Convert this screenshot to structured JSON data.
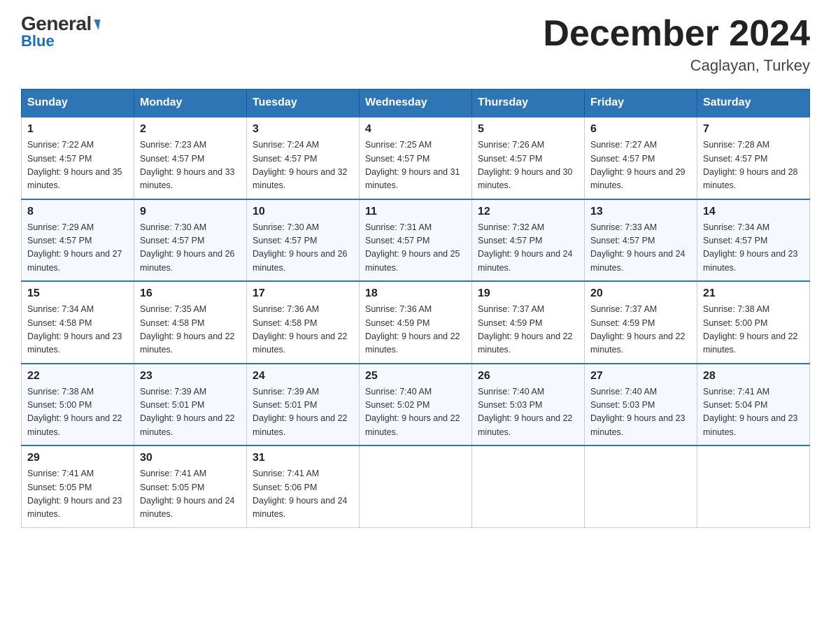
{
  "header": {
    "logo_general": "General",
    "logo_blue": "Blue",
    "month_title": "December 2024",
    "location": "Caglayan, Turkey"
  },
  "days_of_week": [
    "Sunday",
    "Monday",
    "Tuesday",
    "Wednesday",
    "Thursday",
    "Friday",
    "Saturday"
  ],
  "weeks": [
    [
      {
        "day": "1",
        "sunrise": "7:22 AM",
        "sunset": "4:57 PM",
        "daylight": "9 hours and 35 minutes."
      },
      {
        "day": "2",
        "sunrise": "7:23 AM",
        "sunset": "4:57 PM",
        "daylight": "9 hours and 33 minutes."
      },
      {
        "day": "3",
        "sunrise": "7:24 AM",
        "sunset": "4:57 PM",
        "daylight": "9 hours and 32 minutes."
      },
      {
        "day": "4",
        "sunrise": "7:25 AM",
        "sunset": "4:57 PM",
        "daylight": "9 hours and 31 minutes."
      },
      {
        "day": "5",
        "sunrise": "7:26 AM",
        "sunset": "4:57 PM",
        "daylight": "9 hours and 30 minutes."
      },
      {
        "day": "6",
        "sunrise": "7:27 AM",
        "sunset": "4:57 PM",
        "daylight": "9 hours and 29 minutes."
      },
      {
        "day": "7",
        "sunrise": "7:28 AM",
        "sunset": "4:57 PM",
        "daylight": "9 hours and 28 minutes."
      }
    ],
    [
      {
        "day": "8",
        "sunrise": "7:29 AM",
        "sunset": "4:57 PM",
        "daylight": "9 hours and 27 minutes."
      },
      {
        "day": "9",
        "sunrise": "7:30 AM",
        "sunset": "4:57 PM",
        "daylight": "9 hours and 26 minutes."
      },
      {
        "day": "10",
        "sunrise": "7:30 AM",
        "sunset": "4:57 PM",
        "daylight": "9 hours and 26 minutes."
      },
      {
        "day": "11",
        "sunrise": "7:31 AM",
        "sunset": "4:57 PM",
        "daylight": "9 hours and 25 minutes."
      },
      {
        "day": "12",
        "sunrise": "7:32 AM",
        "sunset": "4:57 PM",
        "daylight": "9 hours and 24 minutes."
      },
      {
        "day": "13",
        "sunrise": "7:33 AM",
        "sunset": "4:57 PM",
        "daylight": "9 hours and 24 minutes."
      },
      {
        "day": "14",
        "sunrise": "7:34 AM",
        "sunset": "4:57 PM",
        "daylight": "9 hours and 23 minutes."
      }
    ],
    [
      {
        "day": "15",
        "sunrise": "7:34 AM",
        "sunset": "4:58 PM",
        "daylight": "9 hours and 23 minutes."
      },
      {
        "day": "16",
        "sunrise": "7:35 AM",
        "sunset": "4:58 PM",
        "daylight": "9 hours and 22 minutes."
      },
      {
        "day": "17",
        "sunrise": "7:36 AM",
        "sunset": "4:58 PM",
        "daylight": "9 hours and 22 minutes."
      },
      {
        "day": "18",
        "sunrise": "7:36 AM",
        "sunset": "4:59 PM",
        "daylight": "9 hours and 22 minutes."
      },
      {
        "day": "19",
        "sunrise": "7:37 AM",
        "sunset": "4:59 PM",
        "daylight": "9 hours and 22 minutes."
      },
      {
        "day": "20",
        "sunrise": "7:37 AM",
        "sunset": "4:59 PM",
        "daylight": "9 hours and 22 minutes."
      },
      {
        "day": "21",
        "sunrise": "7:38 AM",
        "sunset": "5:00 PM",
        "daylight": "9 hours and 22 minutes."
      }
    ],
    [
      {
        "day": "22",
        "sunrise": "7:38 AM",
        "sunset": "5:00 PM",
        "daylight": "9 hours and 22 minutes."
      },
      {
        "day": "23",
        "sunrise": "7:39 AM",
        "sunset": "5:01 PM",
        "daylight": "9 hours and 22 minutes."
      },
      {
        "day": "24",
        "sunrise": "7:39 AM",
        "sunset": "5:01 PM",
        "daylight": "9 hours and 22 minutes."
      },
      {
        "day": "25",
        "sunrise": "7:40 AM",
        "sunset": "5:02 PM",
        "daylight": "9 hours and 22 minutes."
      },
      {
        "day": "26",
        "sunrise": "7:40 AM",
        "sunset": "5:03 PM",
        "daylight": "9 hours and 22 minutes."
      },
      {
        "day": "27",
        "sunrise": "7:40 AM",
        "sunset": "5:03 PM",
        "daylight": "9 hours and 23 minutes."
      },
      {
        "day": "28",
        "sunrise": "7:41 AM",
        "sunset": "5:04 PM",
        "daylight": "9 hours and 23 minutes."
      }
    ],
    [
      {
        "day": "29",
        "sunrise": "7:41 AM",
        "sunset": "5:05 PM",
        "daylight": "9 hours and 23 minutes."
      },
      {
        "day": "30",
        "sunrise": "7:41 AM",
        "sunset": "5:05 PM",
        "daylight": "9 hours and 24 minutes."
      },
      {
        "day": "31",
        "sunrise": "7:41 AM",
        "sunset": "5:06 PM",
        "daylight": "9 hours and 24 minutes."
      },
      null,
      null,
      null,
      null
    ]
  ]
}
